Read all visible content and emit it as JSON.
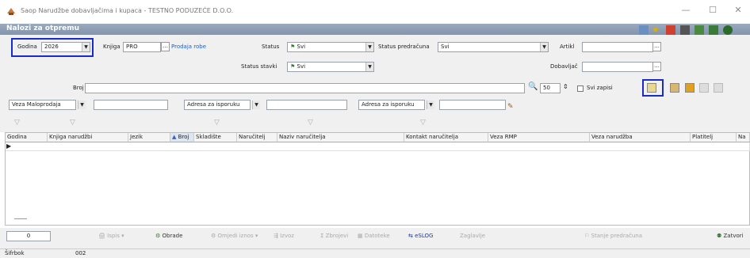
{
  "window": {
    "title": "Saop Narudžbe dobavljačima i kupaca - TESTNO PODUZEĆE D.O.O."
  },
  "panel": {
    "title": "Nalozi za otpremu"
  },
  "filters": {
    "godina_label": "Godina",
    "godina_value": "2026",
    "knjiga_label": "Knjiga",
    "knjiga_value": "PRO",
    "knjiga_link": "Prodaja robe",
    "status_label": "Status",
    "status_value": "Svi",
    "status_stavki_label": "Status stavki",
    "status_stavki_value": "Svi",
    "status_predracuna_label": "Status predračuna",
    "status_predracuna_value": "Svi",
    "artikl_label": "Artikl",
    "dobavljac_label": "Dobavljač",
    "broj_label": "Broj",
    "limit_value": "50",
    "svi_zapisi_label": "Svi zapisi",
    "veza_maloprodaja_label": "Veza Maloprodaja",
    "adresa_label_1": "Adresa za isporuku",
    "adresa_label_2": "Adresa za isporuku"
  },
  "columns": [
    "Godina",
    "Knjiga narudžbi",
    "Jezik",
    "Broj",
    "Skladište",
    "Naručitelj",
    "Naziv naručitelja",
    "Kontakt naručitelja",
    "Veza RMP",
    "Veza narudžba",
    "Platitelj",
    "Na"
  ],
  "bottom": {
    "count": "0",
    "ispis": "Ispis",
    "obrade": "Obrade",
    "omjedi": "Omjedi iznos",
    "izvoz": "Izvoz",
    "zbrojevi": "Zbrojevi",
    "datoteke": "Datoteke",
    "eslog": "eSLOG",
    "zaglavlje": "Zaglavlje",
    "stanje": "Stanje predračuna",
    "zatvori": "Zatvori"
  },
  "status": {
    "left": "Šifrbok",
    "code": "002"
  }
}
